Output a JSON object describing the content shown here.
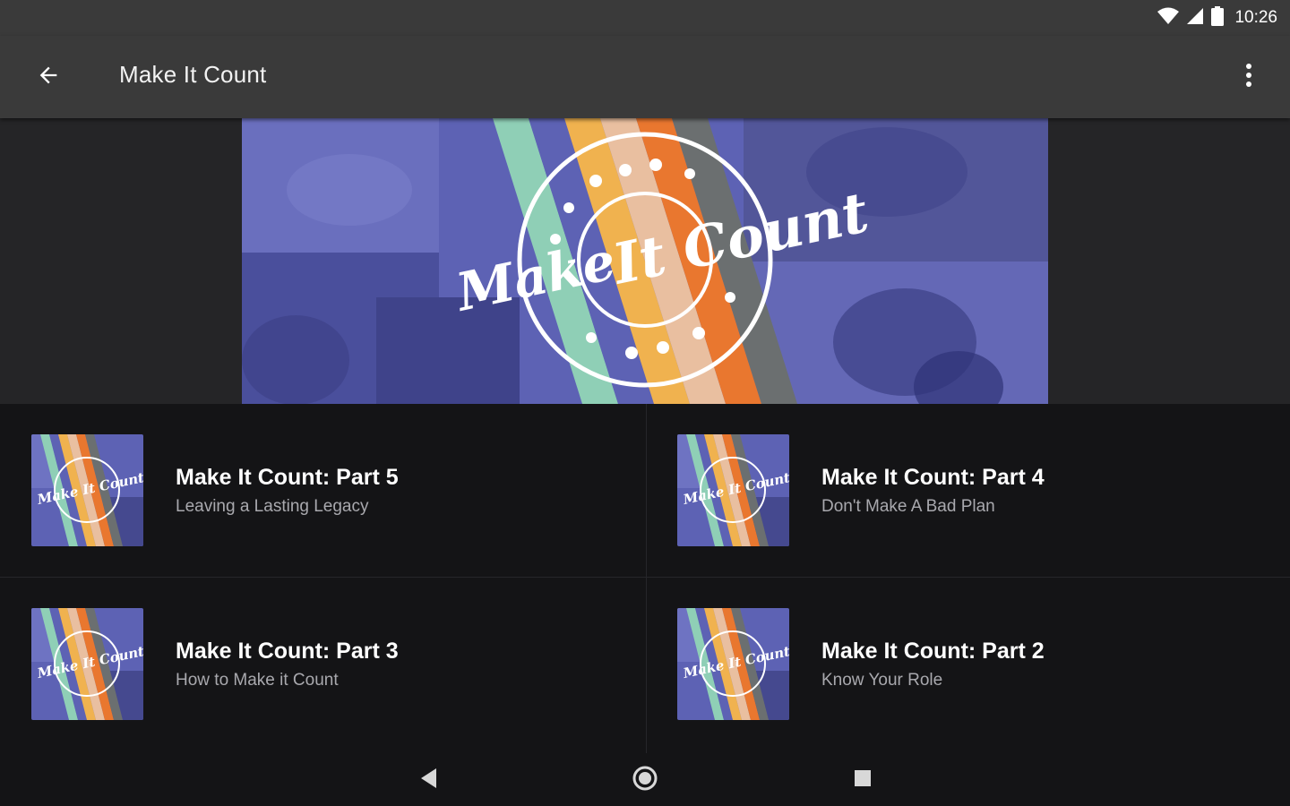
{
  "status_bar": {
    "time": "10:26"
  },
  "app_bar": {
    "title": "Make It Count"
  },
  "hero": {
    "logo_line1": "Make",
    "logo_line2": "It Count"
  },
  "sermons": [
    {
      "title": "Make It Count: Part 5",
      "subtitle": "Leaving a Lasting Legacy"
    },
    {
      "title": "Make It Count: Part 4",
      "subtitle": "Don't Make A Bad Plan"
    },
    {
      "title": "Make It Count: Part 3",
      "subtitle": "How to Make it Count"
    },
    {
      "title": "Make It Count: Part 2",
      "subtitle": "Know Your Role"
    }
  ],
  "thumb_text": "Make It Count",
  "colors": {
    "chrome": "#3a3a3a",
    "background": "#141416",
    "hero_purple": "#5d62b4",
    "stripes": [
      "#8fcfb6",
      "#f0b24f",
      "#e9772f",
      "#6b6f70"
    ]
  },
  "icons": [
    "back-arrow-icon",
    "more-vert-icon",
    "wifi-icon",
    "cell-signal-icon",
    "battery-icon",
    "nav-back-icon",
    "nav-home-icon",
    "nav-recents-icon"
  ]
}
